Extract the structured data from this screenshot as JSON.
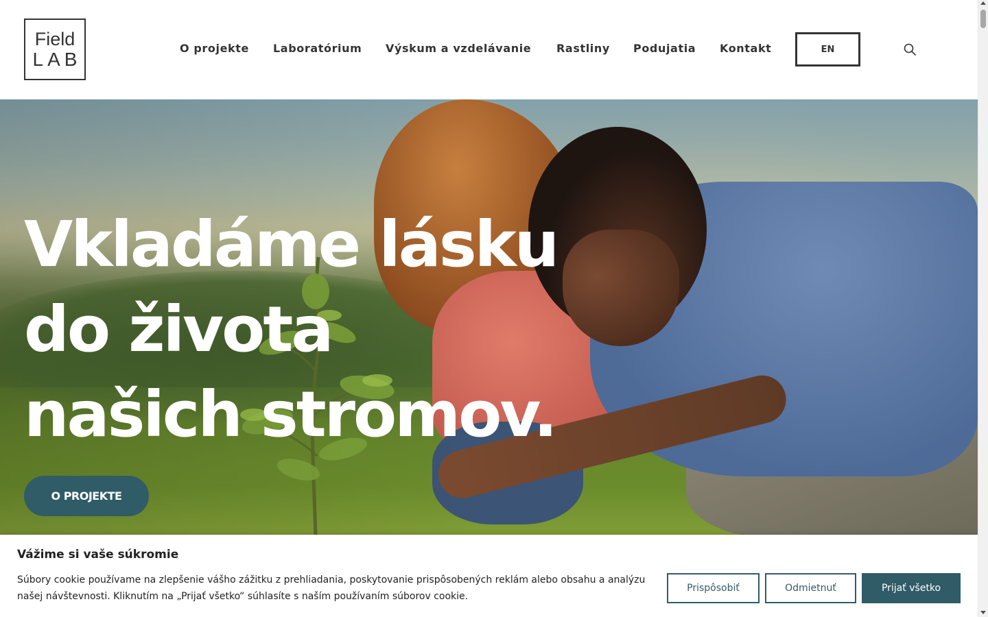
{
  "header": {
    "logo_line1": "Field",
    "logo_line2": "LAB",
    "nav": [
      {
        "label": "O projekte"
      },
      {
        "label": "Laboratórium"
      },
      {
        "label": "Výskum a vzdelávanie"
      },
      {
        "label": "Rastliny"
      },
      {
        "label": "Podujatia"
      },
      {
        "label": "Kontakt"
      }
    ],
    "lang_label": "EN",
    "search_icon": "search-icon"
  },
  "hero": {
    "title_lines": [
      "Vkladáme lásku",
      "do života",
      "našich stromov."
    ],
    "button_label": "O PROJEKTE",
    "accent_color": "#2f5c66"
  },
  "cookie": {
    "title": "Vážime si vaše súkromie",
    "text": "Súbory cookie používame na zlepšenie vášho zážitku z prehliadania, poskytovanie prispôsobených reklám alebo obsahu a analýzu našej návštevnosti. Kliknutím na „Prijať všetko“ súhlasíte s naším používaním súborov cookie.",
    "customize_label": "Prispôsobiť",
    "reject_label": "Odmietnuť",
    "accept_label": "Prijať všetko"
  }
}
